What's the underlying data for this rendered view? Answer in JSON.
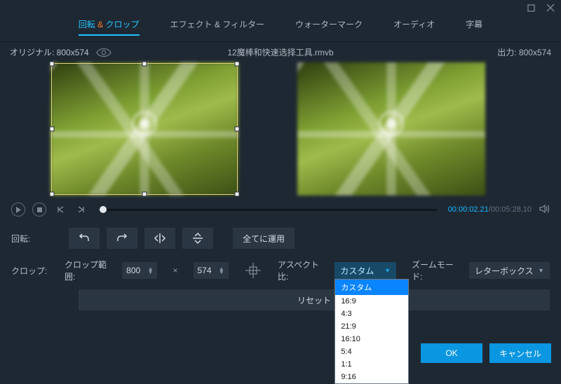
{
  "tabs": {
    "rotate_crop_pre": "回転 ",
    "rotate_crop_amp": "&",
    "rotate_crop_post": " クロップ",
    "effect_filter": "エフェクト & フィルター",
    "watermark": "ウォーターマーク",
    "audio": "オーディオ",
    "subtitle": "字幕"
  },
  "info": {
    "original_label": "オリジナル: 800x574",
    "filename": "12魔棒和快速选择工具.rmvb",
    "output_label": "出力: 800x574"
  },
  "time": {
    "current": "00:00:02.21",
    "total": "00:05:28.10"
  },
  "rotate": {
    "label": "回転:",
    "apply_all": "全てに運用"
  },
  "crop": {
    "label": "クロップ:",
    "range_label": "クロップ範囲:",
    "w": "800",
    "h": "574",
    "reset": "リセット",
    "aspect_label": "アスペクト比:",
    "aspect_selected": "カスタム",
    "aspect_options": [
      "カスタム",
      "16:9",
      "4:3",
      "21:9",
      "16:10",
      "5:4",
      "1:1",
      "9:16"
    ],
    "zoom_label": "ズームモード:",
    "zoom_selected": "レターボックス"
  },
  "footer": {
    "ok": "OK",
    "cancel": "キャンセル"
  }
}
